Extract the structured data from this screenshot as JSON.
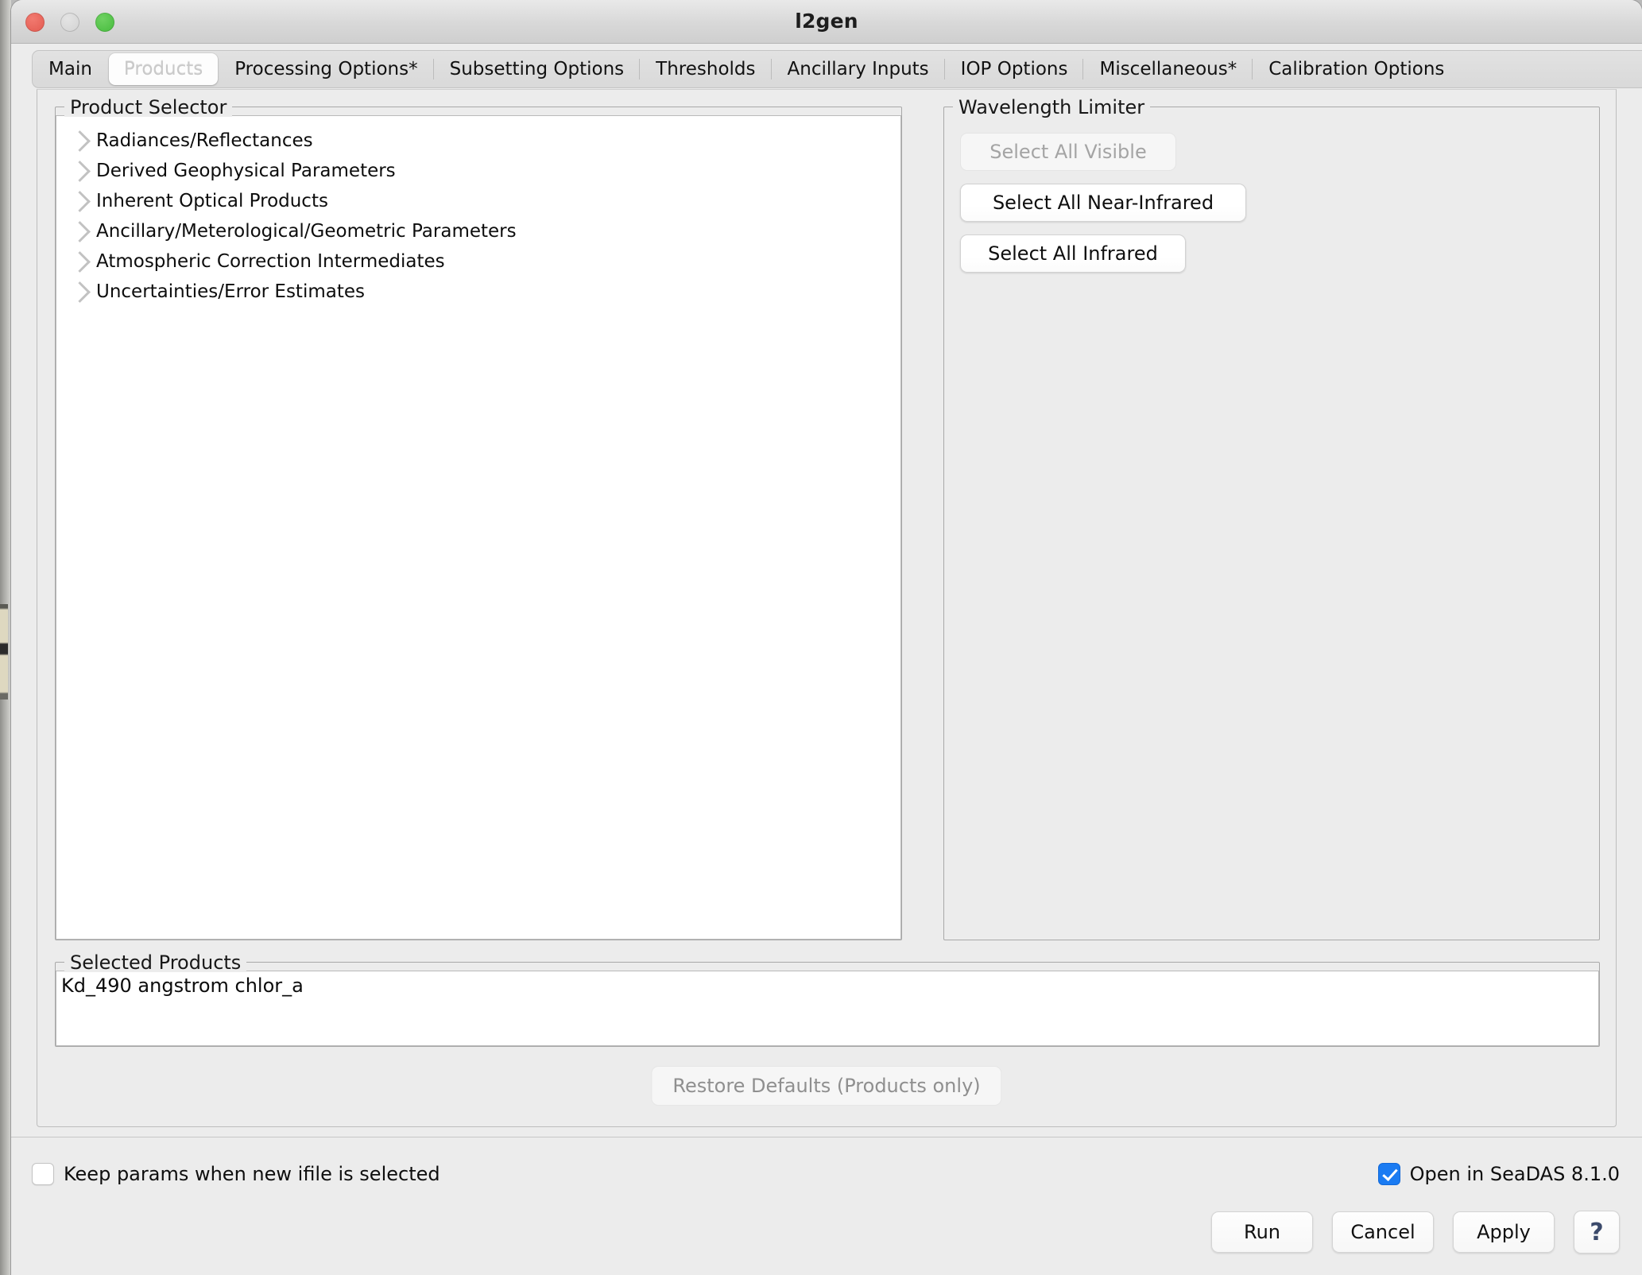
{
  "window": {
    "title": "l2gen",
    "traffic_lights": {
      "close": "close-button",
      "minimize": "minimize-button",
      "maximize": "maximize-button"
    }
  },
  "tabs": [
    {
      "label": "Main",
      "active": false
    },
    {
      "label": "Products",
      "active": true
    },
    {
      "label": "Processing Options*",
      "active": false
    },
    {
      "label": "Subsetting Options",
      "active": false
    },
    {
      "label": "Thresholds",
      "active": false
    },
    {
      "label": "Ancillary Inputs",
      "active": false
    },
    {
      "label": "IOP Options",
      "active": false
    },
    {
      "label": "Miscellaneous*",
      "active": false
    },
    {
      "label": "Calibration Options",
      "active": false
    }
  ],
  "product_selector": {
    "title": "Product Selector",
    "items": [
      {
        "label": "Radiances/Reflectances",
        "expanded": false
      },
      {
        "label": "Derived Geophysical Parameters",
        "expanded": false
      },
      {
        "label": "Inherent Optical Products",
        "expanded": false
      },
      {
        "label": "Ancillary/Meterological/Geometric Parameters",
        "expanded": false
      },
      {
        "label": "Atmospheric Correction Intermediates",
        "expanded": false
      },
      {
        "label": "Uncertainties/Error Estimates",
        "expanded": false
      }
    ]
  },
  "wavelength_limiter": {
    "title": "Wavelength Limiter",
    "buttons": [
      {
        "label": "Select All Visible",
        "enabled": false
      },
      {
        "label": "Select All Near-Infrared",
        "enabled": true
      },
      {
        "label": "Select All Infrared",
        "enabled": true
      }
    ]
  },
  "selected_products": {
    "title": "Selected Products",
    "value": "Kd_490 angstrom chlor_a"
  },
  "restore_defaults": {
    "label": "Restore Defaults (Products only)",
    "enabled": false
  },
  "footer": {
    "keep_params": {
      "label": "Keep params when new ifile is selected",
      "checked": false
    },
    "open_in_seadas": {
      "label": "Open in SeaDAS 8.1.0",
      "checked": true
    },
    "buttons": [
      {
        "label": "Run"
      },
      {
        "label": "Cancel"
      },
      {
        "label": "Apply"
      }
    ],
    "help_label": "?"
  },
  "colors": {
    "accent_checkbox": "#1a7bf2",
    "window_bg": "#ececec",
    "panel_bg": "#ffffff",
    "close": "#e2594f",
    "minimize": "#d2d2d2",
    "maximize": "#45bb3c",
    "help_glyph": "#3b4a6b"
  }
}
